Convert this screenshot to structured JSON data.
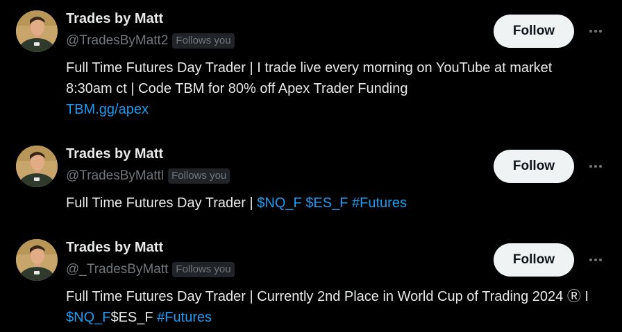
{
  "accounts": [
    {
      "name": "Trades by Matt",
      "handle": "@TradesByMatt2",
      "badge": "Follows you",
      "follow_label": "Follow",
      "bio": [
        {
          "text": "Full Time Futures Day Trader | I trade live every morning on YouTube at market 8:30am ct | Code TBM for 80% off Apex Trader Funding",
          "link": false
        },
        {
          "text": "TBM.gg/apex",
          "link": true,
          "block": true
        }
      ]
    },
    {
      "name": "Trades by Matt",
      "handle": "@TradesByMattl",
      "badge": "Follows you",
      "follow_label": "Follow",
      "bio": [
        {
          "text": "Full Time Futures Day Trader | ",
          "link": false
        },
        {
          "text": "$NQ_F",
          "link": true
        },
        {
          "text": " ",
          "link": false
        },
        {
          "text": "$ES_F",
          "link": true
        },
        {
          "text": " ",
          "link": false
        },
        {
          "text": "#Futures",
          "link": true
        }
      ]
    },
    {
      "name": "Trades by Matt",
      "handle": "@_TradesByMatt",
      "badge": "Follows you",
      "follow_label": "Follow",
      "bio": [
        {
          "text": "Full Time Futures Day Trader | Currently 2nd Place in World Cup of Trading 2024 Ⓡ I ",
          "link": false
        },
        {
          "text": "$NQ_F",
          "link": true
        },
        {
          "text": "$ES_F ",
          "link": false
        },
        {
          "text": "#Futures",
          "link": true
        }
      ]
    }
  ],
  "icons": {
    "avatar": "profile-photo",
    "more": "more-horizontal-icon"
  },
  "colors": {
    "background": "#000000",
    "text": "#e7e9ea",
    "secondary": "#71767b",
    "link": "#1d9bf0",
    "button_bg": "#eff3f4"
  }
}
